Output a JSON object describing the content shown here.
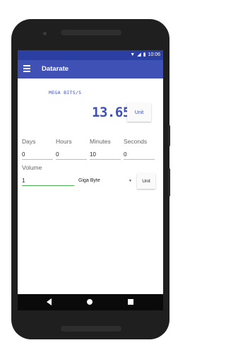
{
  "status_bar": {
    "time": "10:06"
  },
  "app_bar": {
    "title": "Datarate"
  },
  "result": {
    "unit_label": "MEGA BITS/S",
    "value": "13.65",
    "unit_button": "Unit"
  },
  "time_fields": [
    {
      "label": "Days",
      "value": "0"
    },
    {
      "label": "Hours",
      "value": "0"
    },
    {
      "label": "Minutes",
      "value": "10"
    },
    {
      "label": "Seconds",
      "value": "0"
    }
  ],
  "volume": {
    "label": "Volume",
    "value": "1",
    "unit_selected": "Giga Byte",
    "unit_button": "Unit"
  },
  "colors": {
    "primary": "#3f51b5",
    "primary_dark": "#2b3fa2",
    "accent_underline": "#4caf50"
  }
}
